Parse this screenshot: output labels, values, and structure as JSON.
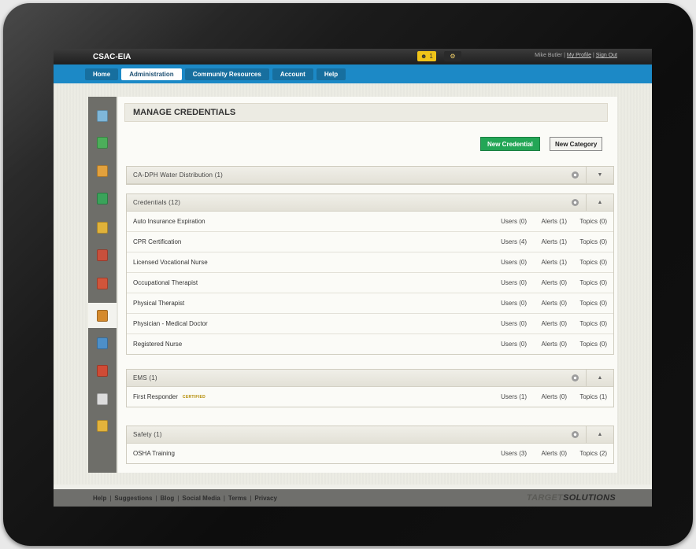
{
  "app": {
    "brand": "CSAC-EIA",
    "notification_count": "1"
  },
  "user": {
    "name": "Mike Butler",
    "my_profile": "My Profile",
    "sign_out": "Sign Out",
    "separator": "|"
  },
  "nav": {
    "tabs": [
      {
        "label": "Home"
      },
      {
        "label": "Administration"
      },
      {
        "label": "Community Resources"
      },
      {
        "label": "Account"
      },
      {
        "label": "Help"
      }
    ]
  },
  "page": {
    "title": "MANAGE CREDENTIALS"
  },
  "actions": {
    "new_credential": "New Credential",
    "new_category": "New Category"
  },
  "categories": [
    {
      "title": "CA-DPH Water Distribution (1)",
      "expanded": false,
      "toggle": "▼",
      "items": []
    },
    {
      "title": "Credentials (12)",
      "expanded": true,
      "toggle": "▲",
      "items": [
        {
          "name": "Auto Insurance Expiration",
          "users": "Users (0)",
          "alerts": "Alerts (1)",
          "topics": "Topics (0)"
        },
        {
          "name": "CPR Certification",
          "users": "Users (4)",
          "alerts": "Alerts (1)",
          "topics": "Topics (0)"
        },
        {
          "name": "Licensed Vocational Nurse",
          "users": "Users (0)",
          "alerts": "Alerts (1)",
          "topics": "Topics (0)"
        },
        {
          "name": "Occupational Therapist",
          "users": "Users (0)",
          "alerts": "Alerts (0)",
          "topics": "Topics (0)"
        },
        {
          "name": "Physical Therapist",
          "users": "Users (0)",
          "alerts": "Alerts (0)",
          "topics": "Topics (0)"
        },
        {
          "name": "Physician - Medical Doctor",
          "users": "Users (0)",
          "alerts": "Alerts (0)",
          "topics": "Topics (0)"
        },
        {
          "name": "Registered Nurse",
          "users": "Users (0)",
          "alerts": "Alerts (0)",
          "topics": "Topics (0)"
        }
      ]
    },
    {
      "title": "EMS (1)",
      "expanded": true,
      "toggle": "▲",
      "items": [
        {
          "name": "First Responder",
          "badge": "CERTIFIED",
          "users": "Users (1)",
          "alerts": "Alerts (0)",
          "topics": "Topics (1)"
        }
      ]
    },
    {
      "title": "Safety (1)",
      "expanded": true,
      "toggle": "▲",
      "items": [
        {
          "name": "OSHA Training",
          "users": "Users (3)",
          "alerts": "Alerts (0)",
          "topics": "Topics (2)"
        }
      ]
    }
  ],
  "sidebar": {
    "icons": [
      {
        "name": "dashboard-icon",
        "color": "#7fb7d9"
      },
      {
        "name": "add-document-icon",
        "color": "#4cae5a"
      },
      {
        "name": "users-icon",
        "color": "#e2a13d"
      },
      {
        "name": "add-record-icon",
        "color": "#3aa35a"
      },
      {
        "name": "folder-icon",
        "color": "#e0b23a"
      },
      {
        "name": "report-icon",
        "color": "#c8503c"
      },
      {
        "name": "approval-icon",
        "color": "#d0553b"
      },
      {
        "name": "credentials-icon",
        "color": "#d58a2c"
      },
      {
        "name": "settings-document-icon",
        "color": "#4d8fc8"
      },
      {
        "name": "alert-document-icon",
        "color": "#cf4b35"
      },
      {
        "name": "edit-icon",
        "color": "#dcdcdc"
      },
      {
        "name": "library-icon",
        "color": "#e3b33c"
      }
    ]
  },
  "footer": {
    "links": [
      "Help",
      "Suggestions",
      "Blog",
      "Social Media",
      "Terms",
      "Privacy"
    ],
    "logo_text_1": "TARGET",
    "logo_text_2": "SOLUTIONS"
  },
  "colors": {
    "nav_blue": "#1c89c6",
    "new_credential_green": "#23a656",
    "badge_gold": "#b38a00"
  }
}
